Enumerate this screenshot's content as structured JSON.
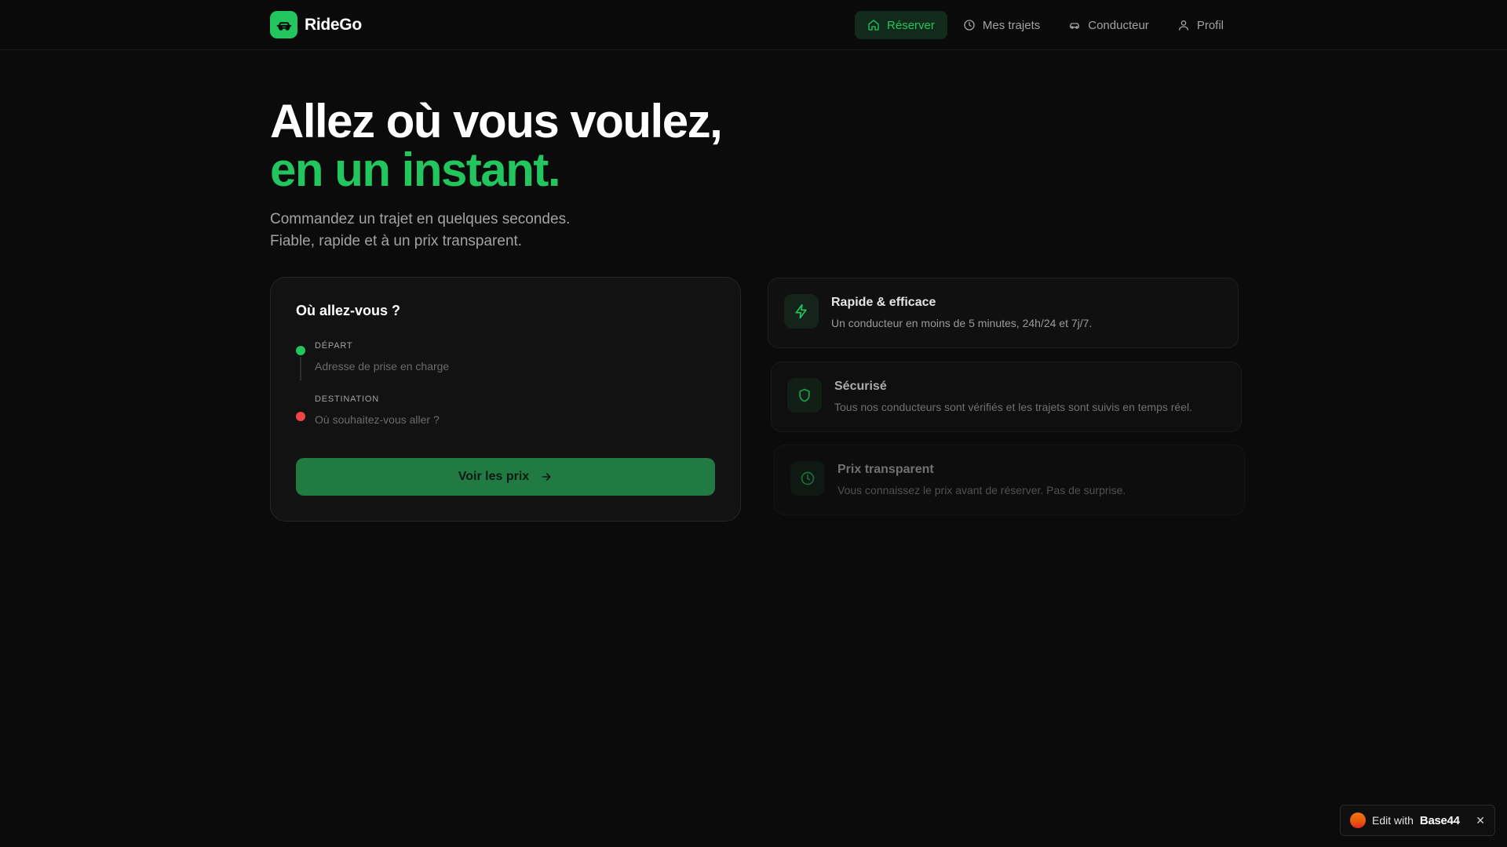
{
  "header": {
    "brand": "RideGo",
    "nav": [
      {
        "label": "Réserver",
        "icon": "home-icon",
        "active": true
      },
      {
        "label": "Mes trajets",
        "icon": "clock-icon",
        "active": false
      },
      {
        "label": "Conducteur",
        "icon": "car-icon",
        "active": false
      },
      {
        "label": "Profil",
        "icon": "user-icon",
        "active": false
      }
    ]
  },
  "hero": {
    "line1": "Allez où vous voulez,",
    "line2": "en un instant.",
    "subtitle": "Commandez un trajet en quelques secondes. Fiable, rapide et à un prix transparent."
  },
  "booking": {
    "title": "Où allez-vous ?",
    "departure": {
      "label": "DÉPART",
      "placeholder": "Adresse de prise en charge",
      "value": ""
    },
    "destination": {
      "label": "DESTINATION",
      "placeholder": "Où souhaitez-vous aller ?",
      "value": ""
    },
    "cta_label": "Voir les prix"
  },
  "features": [
    {
      "icon": "bolt-icon",
      "title": "Rapide & efficace",
      "description": "Un conducteur en moins de 5 minutes, 24h/24 et 7j/7."
    },
    {
      "icon": "shield-icon",
      "title": "Sécurisé",
      "description": "Tous nos conducteurs sont vérifiés et les trajets sont suivis en temps réel."
    },
    {
      "icon": "clock-icon",
      "title": "Prix transparent",
      "description": "Vous connaissez le prix avant de réserver. Pas de surprise."
    }
  ],
  "badge": {
    "prefix": "Edit with",
    "brand": "Base44",
    "close": "✕"
  },
  "colors": {
    "accent": "#22c55e",
    "background": "#0b0b0b",
    "destination_dot": "#ef4444",
    "cta": "#217a42"
  }
}
